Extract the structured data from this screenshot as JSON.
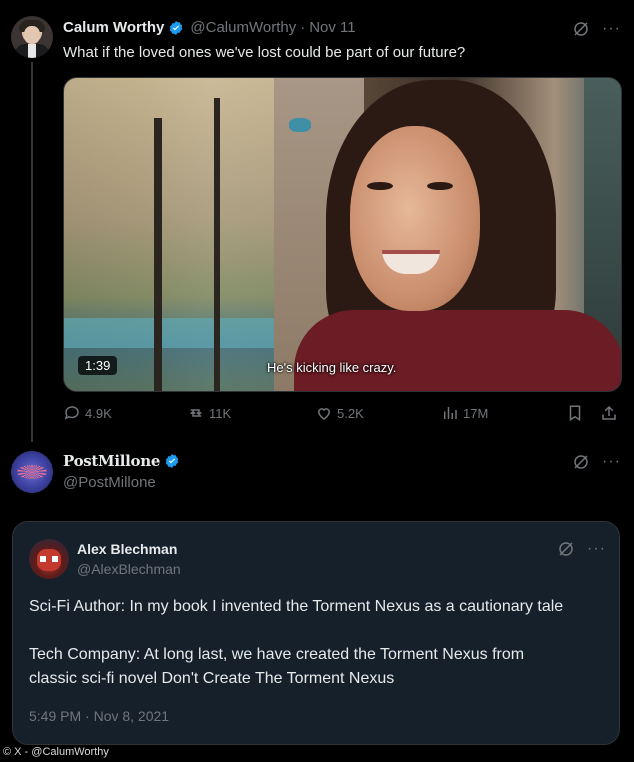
{
  "tweet1": {
    "name": "Calum Worthy",
    "handle": "@CalumWorthy",
    "separator": "·",
    "date": "Nov 11",
    "text": "What if the loved ones we've lost could be part of our future?",
    "media": {
      "duration": "1:39",
      "caption": "He's kicking like crazy."
    },
    "stats": {
      "replies": "4.9K",
      "reposts": "11K",
      "likes": "5.2K",
      "views": "17M"
    }
  },
  "tweet2": {
    "name": "PostMillone",
    "handle": "@PostMillone"
  },
  "quoted": {
    "name": "Alex Blechman",
    "handle": "@AlexBlechman",
    "para1": "Sci-Fi Author: In my book I invented the Torment Nexus as a cautionary tale",
    "para2_line1": "Tech Company: At long last, we have created the Torment Nexus from",
    "para2_line2": "classic sci-fi novel Don't Create The Torment Nexus",
    "timestamp": "5:49 PM · Nov 8, 2021"
  },
  "credit": "© X - @CalumWorthy",
  "icons": {
    "more": "···",
    "verified_color": "#1d9bf0",
    "muted_color": "#71767b"
  }
}
